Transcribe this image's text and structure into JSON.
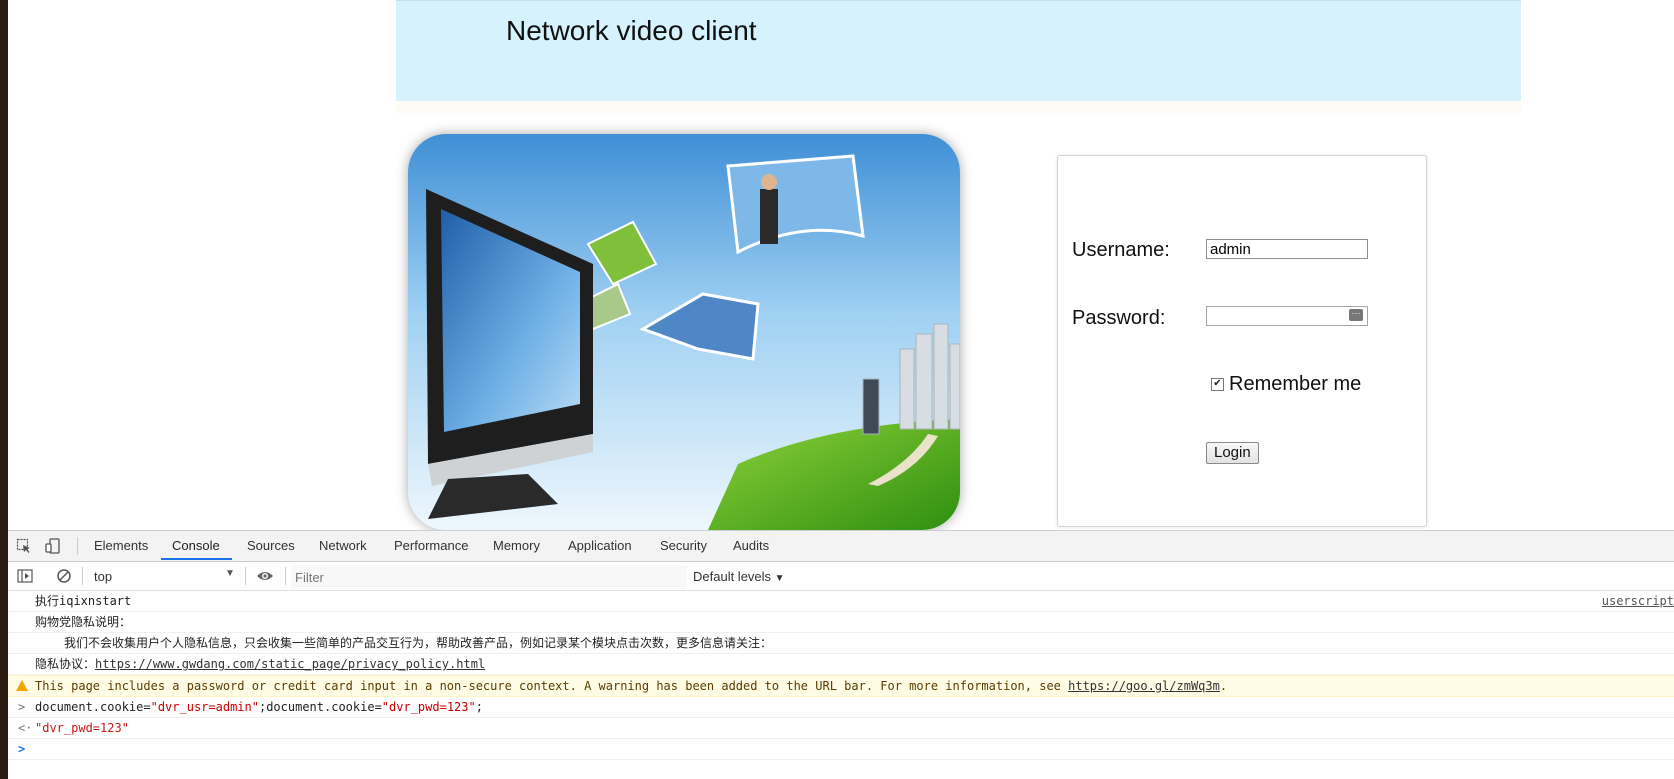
{
  "page": {
    "title": "Network video client",
    "login": {
      "username_label": "Username:",
      "username_value": "admin",
      "password_label": "Password:",
      "password_value": "",
      "remember_label": "Remember me",
      "remember_checked": true,
      "login_button": "Login"
    }
  },
  "devtools": {
    "tabs": [
      "Elements",
      "Console",
      "Sources",
      "Network",
      "Performance",
      "Memory",
      "Application",
      "Security",
      "Audits"
    ],
    "active_tab": "Console",
    "context": "top",
    "filter_placeholder": "Filter",
    "levels": "Default levels",
    "console": {
      "line1": "执行iqixnstart",
      "line1_source": "userscript",
      "line2": "购物党隐私说明：",
      "line3": "我们不会收集用户个人隐私信息，只会收集一些简单的产品交互行为，帮助改善产品，例如记录某个模块点击次数，更多信息请关注：",
      "line4_prefix": "隐私协议：",
      "line4_link": "https://www.gwdang.com/static_page/privacy_policy.html",
      "warning_text": "This page includes a password or credit card input in a non-secure context. A warning has been added to the URL bar. For more information, see ",
      "warning_link": "https://goo.gl/zmWq3m",
      "warning_end": ".",
      "cmd_part1": "document.cookie=",
      "cmd_str1": "\"dvr_usr=admin\"",
      "cmd_part2": ";document.cookie=",
      "cmd_str2": "\"dvr_pwd=123\"",
      "cmd_end": ";",
      "result": "\"dvr_pwd=123\""
    }
  },
  "colors": {
    "header_bg": "#d6f2fc",
    "tab_accent": "#1a73e8",
    "warning_bg": "#fffbe5",
    "string_red": "#c80000"
  },
  "icons": [
    "inspect-icon",
    "device-toolbar-icon",
    "sidebar-toggle-icon",
    "clear-console-icon",
    "eye-icon",
    "password-key-icon",
    "warning-icon"
  ]
}
